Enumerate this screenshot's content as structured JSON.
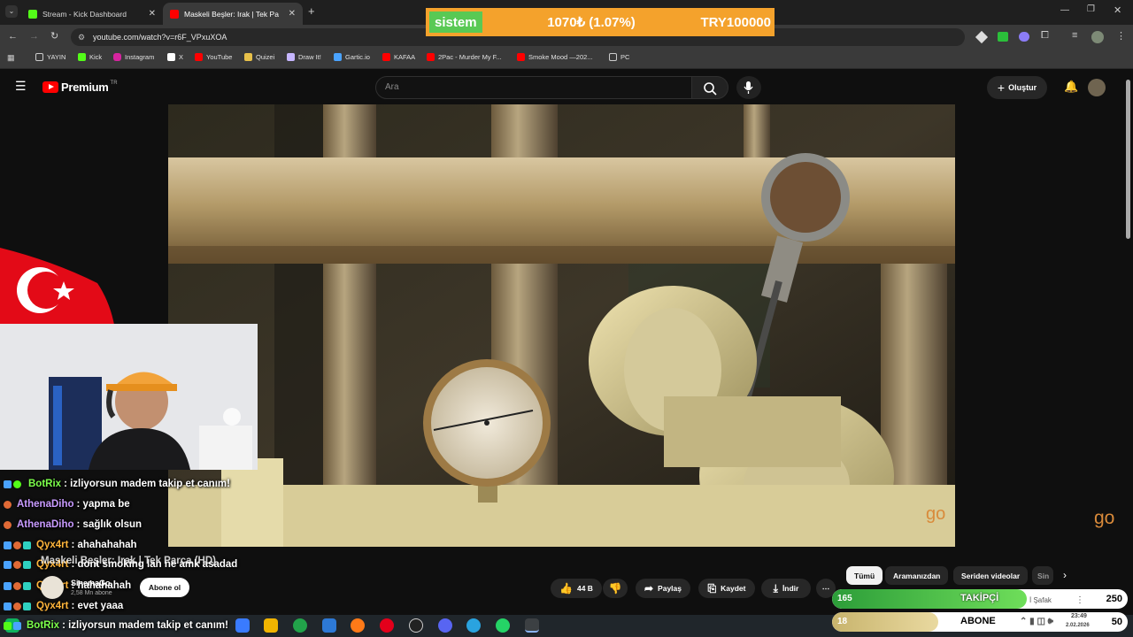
{
  "browser": {
    "tabs": [
      {
        "title": "Stream - Kick Dashboard",
        "active": false
      },
      {
        "title": "Maskeli Beşler: Irak | Tek Pa",
        "active": true
      }
    ],
    "url": "youtube.com/watch?v=r6F_VPxuXOA",
    "bookmarks": [
      "YAYIN",
      "Kick",
      "Instagram",
      "X",
      "YouTube",
      "Quizei",
      "Draw It!",
      "Gartic.io",
      "KAFAA",
      "2Pac - Murder My F...",
      "Smoke Mood —202...",
      "PC"
    ]
  },
  "ticker": {
    "label": "sistem",
    "value": "1070₺ (1.07%)",
    "goal": "TRY100000"
  },
  "youtube": {
    "logo_text": "Premium",
    "logo_sup": "TR",
    "search_placeholder": "Ara",
    "create_label": "Oluştur",
    "video_title": "Maskeli Beşler: Irak | Tek Parça (HD)",
    "channel_name": "SinemaGo",
    "channel_subs": "2,58 Mn abone",
    "subscribe_label": "Abone ol",
    "like_count": "44 B",
    "share_label": "Paylaş",
    "save_label": "Kaydet",
    "download_label": "İndir",
    "watermark": "go",
    "chips": [
      "Tümü",
      "Aramanızdan",
      "Seriden videolar",
      "Sin"
    ],
    "side_partial": "İ Şafak"
  },
  "chat": [
    {
      "user": "BotRix",
      "msg": ": izliyorsun madem takip et canım!",
      "color": "#7cff4b"
    },
    {
      "user": "AthenaDiho",
      "msg": ": yapma be",
      "color": "#c89bff"
    },
    {
      "user": "AthenaDiho",
      "msg": ": sağlık olsun",
      "color": "#c89bff"
    },
    {
      "user": "Qyx4rt",
      "msg": ": ahahahahah",
      "color": "#ffb53b"
    },
    {
      "user": "Qyx4rt",
      "msg": ": dont smoking lan ne amk asadad",
      "color": "#ffb53b"
    },
    {
      "user": "Qyx4rt",
      "msg": ": hahahahah",
      "color": "#ffb53b"
    },
    {
      "user": "Qyx4rt",
      "msg": ": evet yaaa",
      "color": "#ffb53b"
    },
    {
      "user": "BotRix",
      "msg": ": izliyorsun madem takip et canım!",
      "color": "#7cff4b"
    }
  ],
  "counters": {
    "followers": {
      "current": "165",
      "label": "TAKİPÇİ",
      "goal": "250",
      "progress": 0.66
    },
    "subs": {
      "current": "18",
      "label": "ABONE",
      "goal": "50",
      "progress": 0.36
    }
  },
  "clock": {
    "time": "23:49",
    "date": "2.02.2026"
  },
  "colors": {
    "kick_green": "#53fc18",
    "youtube_red": "#ff0000",
    "ticker_orange": "#f4a22c"
  }
}
